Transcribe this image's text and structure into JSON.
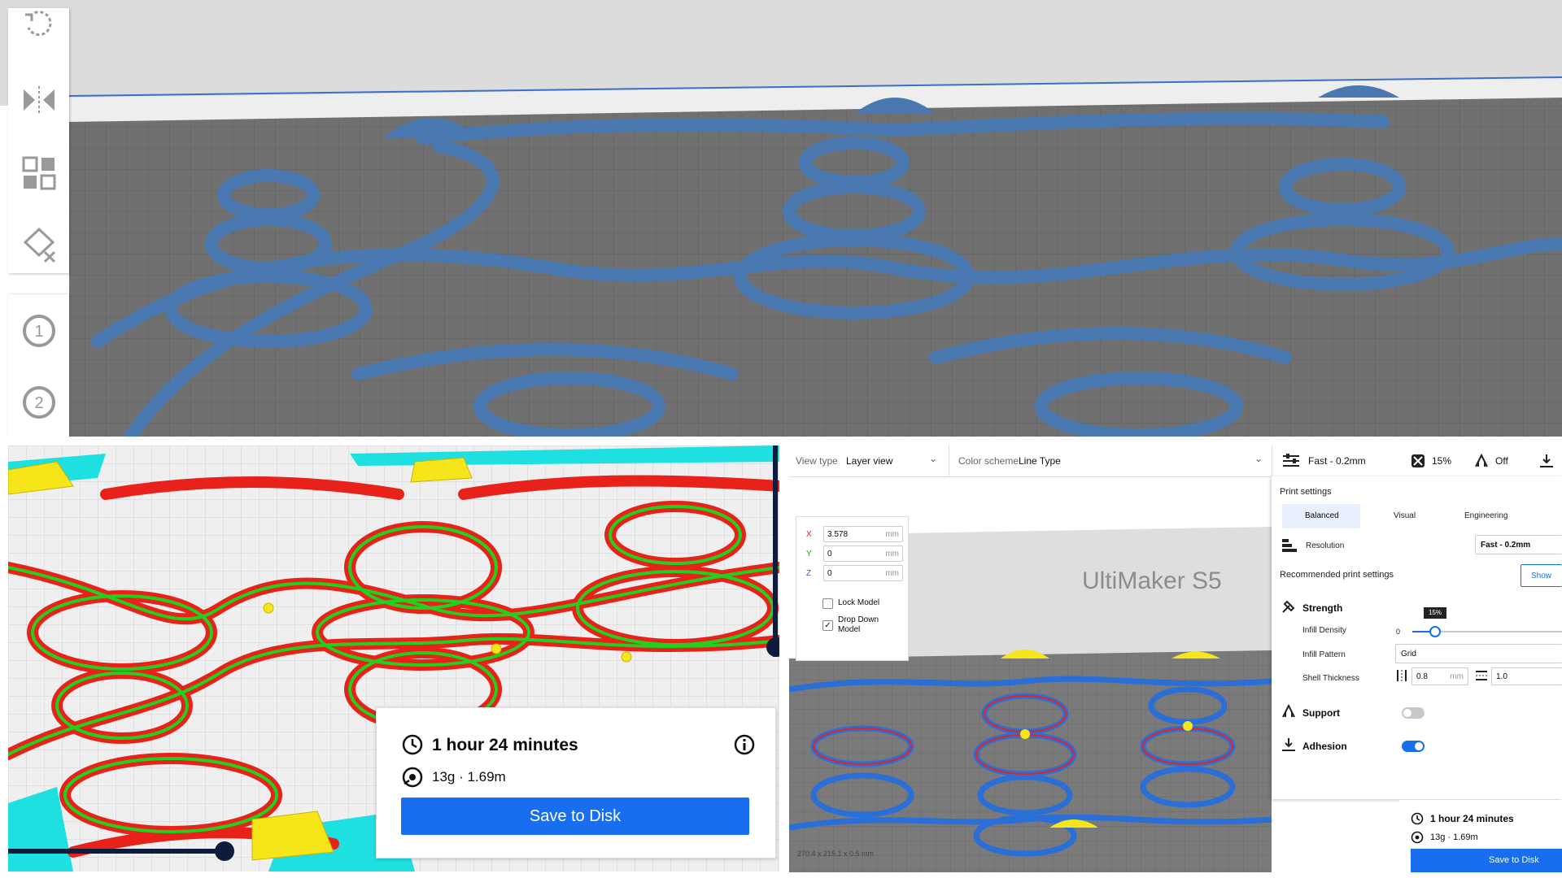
{
  "top_panel": {
    "toolbar": {
      "tools": [
        {
          "name": "rotate-icon"
        },
        {
          "name": "mirror-icon"
        },
        {
          "name": "per-model-settings-icon"
        },
        {
          "name": "support-blocker-icon"
        }
      ],
      "extruders": [
        {
          "name": "extruder-1-icon",
          "label": "1"
        },
        {
          "name": "extruder-2-icon",
          "label": "2"
        }
      ]
    },
    "viewport_colors": {
      "model": "#4a78b0",
      "plate": "#6f6f6f",
      "grid": "#5f5f5f"
    }
  },
  "bottom_left": {
    "time": "1 hour 24 minutes",
    "material": "13g · 1.69m",
    "save_label": "Save to Disk",
    "colors": {
      "wall": "#e8221b",
      "inner_wall": "#22d11f",
      "top": "#f6e619",
      "support": "#1fe0e0"
    }
  },
  "bottom_right": {
    "view_type_label": "View type",
    "view_type_value": "Layer view",
    "color_scheme_label": "Color scheme",
    "color_scheme_value": "Line Type",
    "profile_label": "Fast - 0.2mm",
    "infill_label": "15%",
    "support_label": "Off",
    "transform": {
      "x_label": "X",
      "x_value": "3.578",
      "y_label": "Y",
      "y_value": "0",
      "z_label": "Z",
      "z_value": "0",
      "unit": "mm",
      "lock_model": "Lock Model",
      "drop_down_line1": "Drop Down",
      "drop_down_line2": "Model"
    },
    "printer_name": "UltiMaker S5",
    "print_settings": {
      "title": "Print settings",
      "tabs": [
        "Balanced",
        "Visual",
        "Engineering"
      ],
      "resolution_label": "Resolution",
      "resolution_value": "Fast - 0.2mm",
      "recommended_label": "Recommended print settings",
      "show_button": "Show",
      "strength_label": "Strength",
      "infill_density_label": "Infill Density",
      "infill_min": "0",
      "infill_tooltip": "15%",
      "infill_value_fraction": 0.15,
      "infill_pattern_label": "Infill Pattern",
      "infill_pattern_value": "Grid",
      "shell_label": "Shell Thickness",
      "shell_wall_value": "0.8",
      "shell_unit": "mm",
      "shell_topbottom_value": "1.0",
      "support_label": "Support",
      "support_enabled": false,
      "adhesion_label": "Adhesion",
      "adhesion_enabled": true
    },
    "summary": {
      "time": "1 hour 24 minutes",
      "material": "13g · 1.69m",
      "save_label": "Save to Disk"
    },
    "dimensions_text": "270.4 x 215.1 x 0.5 mm"
  }
}
